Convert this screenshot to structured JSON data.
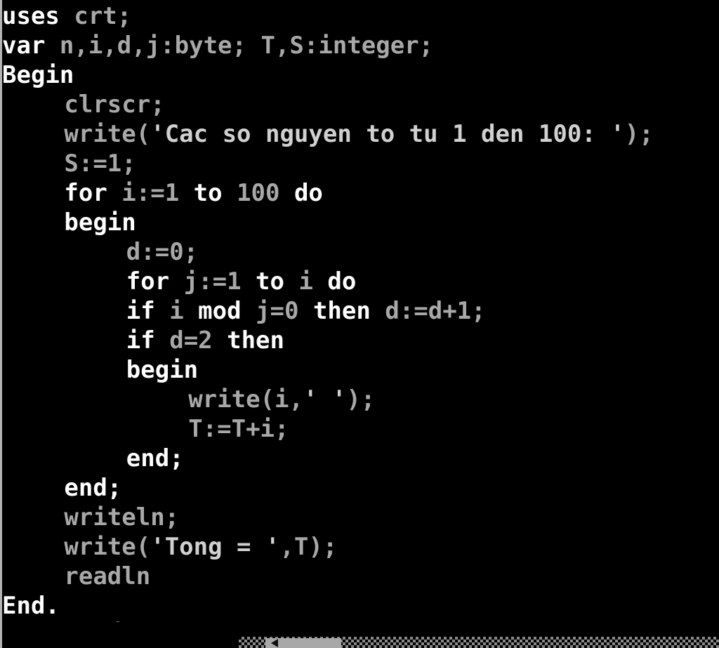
{
  "window": {
    "app": "Turbo Pascal IDE",
    "background_color": "#000000",
    "keyword_color": "#ffffff",
    "identifier_color": "#a8a8a8",
    "string_color": "#d0d0d0",
    "border_color": "#b4b4b4"
  },
  "editor": {
    "language": "pascal",
    "lines": [
      {
        "indent": 0,
        "tokens": [
          {
            "t": "uses ",
            "c": "kw"
          },
          {
            "t": "crt;",
            "c": "id"
          }
        ]
      },
      {
        "indent": 0,
        "tokens": [
          {
            "t": "var ",
            "c": "kw"
          },
          {
            "t": "n,i,d,j:byte; T,S:integer;",
            "c": "id"
          }
        ]
      },
      {
        "indent": 0,
        "tokens": [
          {
            "t": "Begin",
            "c": "kw"
          }
        ]
      },
      {
        "indent": 4,
        "tokens": [
          {
            "t": "clrscr;",
            "c": "id"
          }
        ]
      },
      {
        "indent": 4,
        "tokens": [
          {
            "t": "write(",
            "c": "id"
          },
          {
            "t": "'Cac so nguyen to tu 1 den 100: '",
            "c": "str"
          },
          {
            "t": ");",
            "c": "id"
          }
        ]
      },
      {
        "indent": 4,
        "tokens": [
          {
            "t": "S:=1;",
            "c": "id"
          }
        ]
      },
      {
        "indent": 4,
        "tokens": [
          {
            "t": "for ",
            "c": "kw"
          },
          {
            "t": "i:=1 ",
            "c": "id"
          },
          {
            "t": "to ",
            "c": "kw"
          },
          {
            "t": "100 ",
            "c": "num"
          },
          {
            "t": "do",
            "c": "kw"
          }
        ]
      },
      {
        "indent": 4,
        "tokens": [
          {
            "t": "begin",
            "c": "kw"
          }
        ]
      },
      {
        "indent": 8,
        "tokens": [
          {
            "t": "d:=0;",
            "c": "id"
          }
        ]
      },
      {
        "indent": 8,
        "tokens": [
          {
            "t": "for ",
            "c": "kw"
          },
          {
            "t": "j:=1 ",
            "c": "id"
          },
          {
            "t": "to ",
            "c": "kw"
          },
          {
            "t": "i ",
            "c": "id"
          },
          {
            "t": "do",
            "c": "kw"
          }
        ]
      },
      {
        "indent": 8,
        "tokens": [
          {
            "t": "if ",
            "c": "kw"
          },
          {
            "t": "i ",
            "c": "id"
          },
          {
            "t": "mod ",
            "c": "kw"
          },
          {
            "t": "j=0 ",
            "c": "id"
          },
          {
            "t": "then ",
            "c": "kw"
          },
          {
            "t": "d:=d+1;",
            "c": "id"
          }
        ]
      },
      {
        "indent": 8,
        "tokens": [
          {
            "t": "if ",
            "c": "kw"
          },
          {
            "t": "d=2 ",
            "c": "id"
          },
          {
            "t": "then",
            "c": "kw"
          }
        ]
      },
      {
        "indent": 8,
        "tokens": [
          {
            "t": "begin",
            "c": "kw"
          }
        ]
      },
      {
        "indent": 12,
        "tokens": [
          {
            "t": "write(i,",
            "c": "id"
          },
          {
            "t": "' '",
            "c": "str"
          },
          {
            "t": ");",
            "c": "id"
          }
        ]
      },
      {
        "indent": 12,
        "tokens": [
          {
            "t": "T:=T+i;",
            "c": "id"
          }
        ]
      },
      {
        "indent": 8,
        "tokens": [
          {
            "t": "end;",
            "c": "kw"
          }
        ]
      },
      {
        "indent": 4,
        "tokens": [
          {
            "t": "end;",
            "c": "kw"
          }
        ]
      },
      {
        "indent": 4,
        "tokens": [
          {
            "t": "writeln;",
            "c": "id"
          }
        ]
      },
      {
        "indent": 4,
        "tokens": [
          {
            "t": "write(",
            "c": "id"
          },
          {
            "t": "'Tong = '",
            "c": "str"
          },
          {
            "t": ",T);",
            "c": "id"
          }
        ]
      },
      {
        "indent": 4,
        "tokens": [
          {
            "t": "readln",
            "c": "id"
          }
        ]
      },
      {
        "indent": 0,
        "tokens": [
          {
            "t": "End.",
            "c": "kw"
          }
        ]
      }
    ],
    "bottom_partial_text": "writeln;"
  },
  "scrollbar": {
    "orientation": "horizontal",
    "left_arrow_glyph": "left-arrow"
  }
}
